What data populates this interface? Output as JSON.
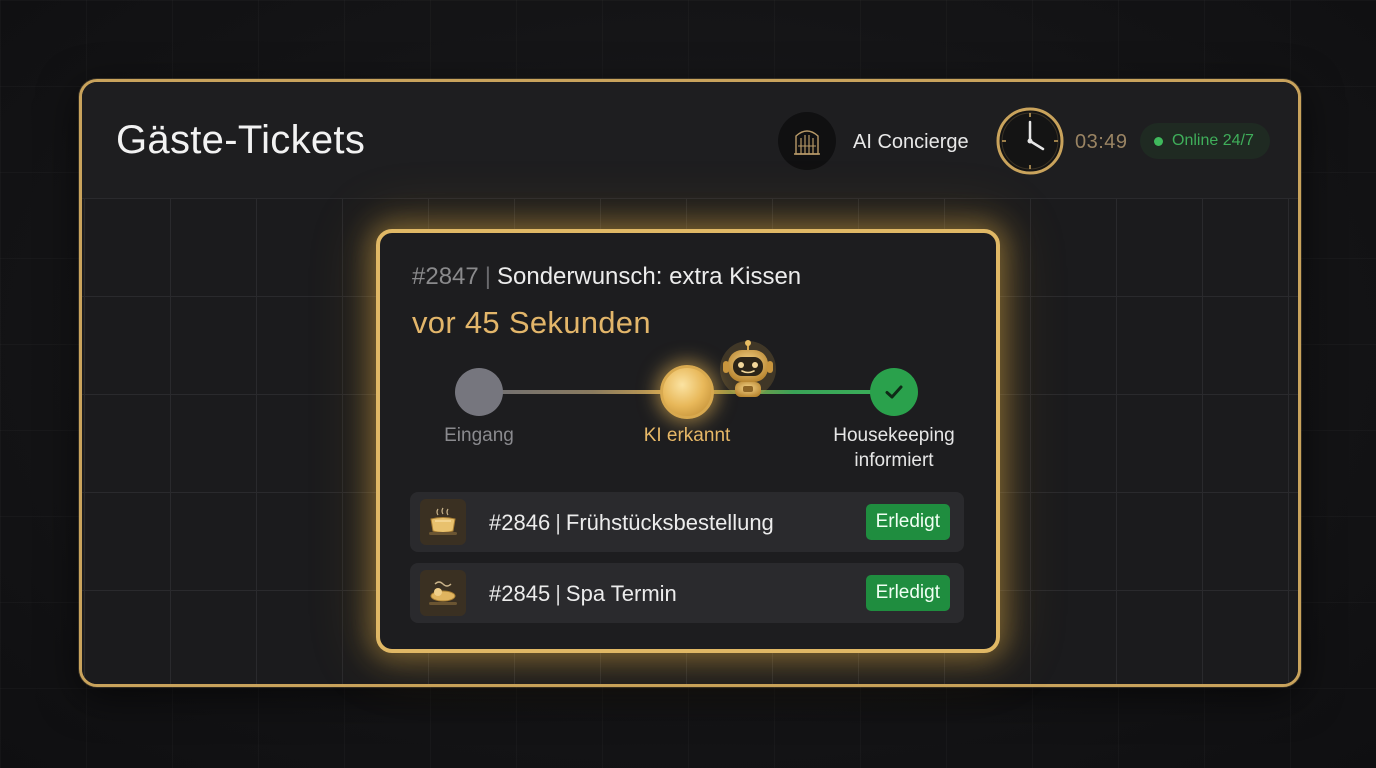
{
  "header": {
    "title": "Gäste-Tickets",
    "assistant_name": "AI Concierge",
    "time": "03:49",
    "status": "Online 24/7"
  },
  "current_ticket": {
    "number": "#2847",
    "subject": "Sonderwunsch: extra Kissen",
    "age": "vor 45 Sekunden",
    "steps": [
      {
        "label": "Eingang",
        "state": "done-grey"
      },
      {
        "label": "KI erkannt",
        "state": "active"
      },
      {
        "label": "Housekeeping",
        "label2": "informiert",
        "state": "complete"
      }
    ]
  },
  "tickets": [
    {
      "number": "#2846",
      "subject": "Frühstücksbestellung",
      "status": "Erledigt",
      "icon": "breakfast-tray-icon"
    },
    {
      "number": "#2845",
      "subject": "Spa Termin",
      "status": "Erledigt",
      "icon": "spa-icon"
    }
  ],
  "colors": {
    "gold": "#e0b865",
    "success": "#1f8d3f",
    "online": "#3fb95c"
  }
}
